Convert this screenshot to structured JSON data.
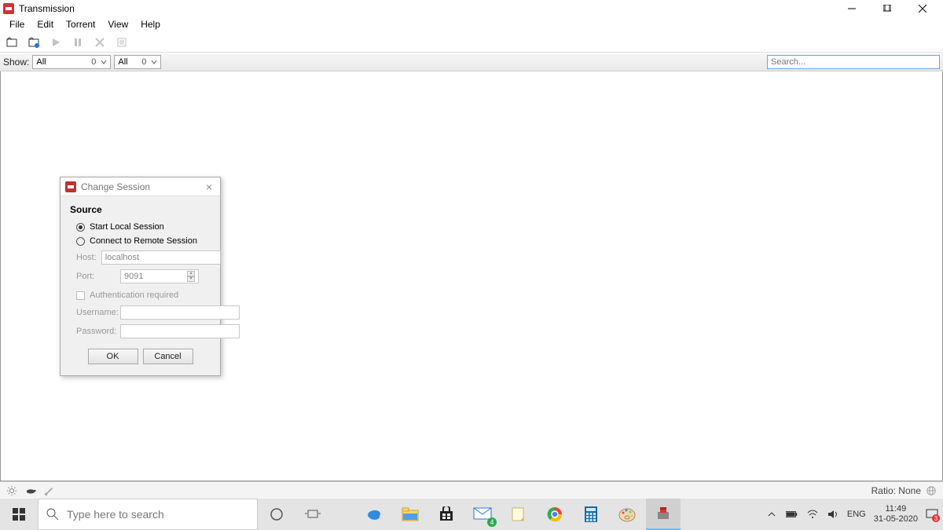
{
  "app": {
    "title": "Transmission"
  },
  "menu": {
    "items": [
      "File",
      "Edit",
      "Torrent",
      "View",
      "Help"
    ]
  },
  "filter": {
    "show_label": "Show:",
    "combo1": {
      "text": "All",
      "count": "0"
    },
    "combo2": {
      "text": "All",
      "count": "0"
    },
    "search_placeholder": "Search..."
  },
  "dialog": {
    "title": "Change Session",
    "section": "Source",
    "radio_local": "Start Local Session",
    "radio_remote": "Connect to Remote Session",
    "host_label": "Host:",
    "host_value": "localhost",
    "port_label": "Port:",
    "port_value": "9091",
    "auth_label": "Authentication required",
    "user_label": "Username:",
    "pass_label": "Password:",
    "ok": "OK",
    "cancel": "Cancel"
  },
  "status": {
    "ratio": "Ratio: None"
  },
  "taskbar": {
    "search_placeholder": "Type here to search",
    "lang": "ENG",
    "time": "11:49",
    "date": "31-05-2020",
    "mail_badge": "4",
    "action_badge": "3"
  }
}
